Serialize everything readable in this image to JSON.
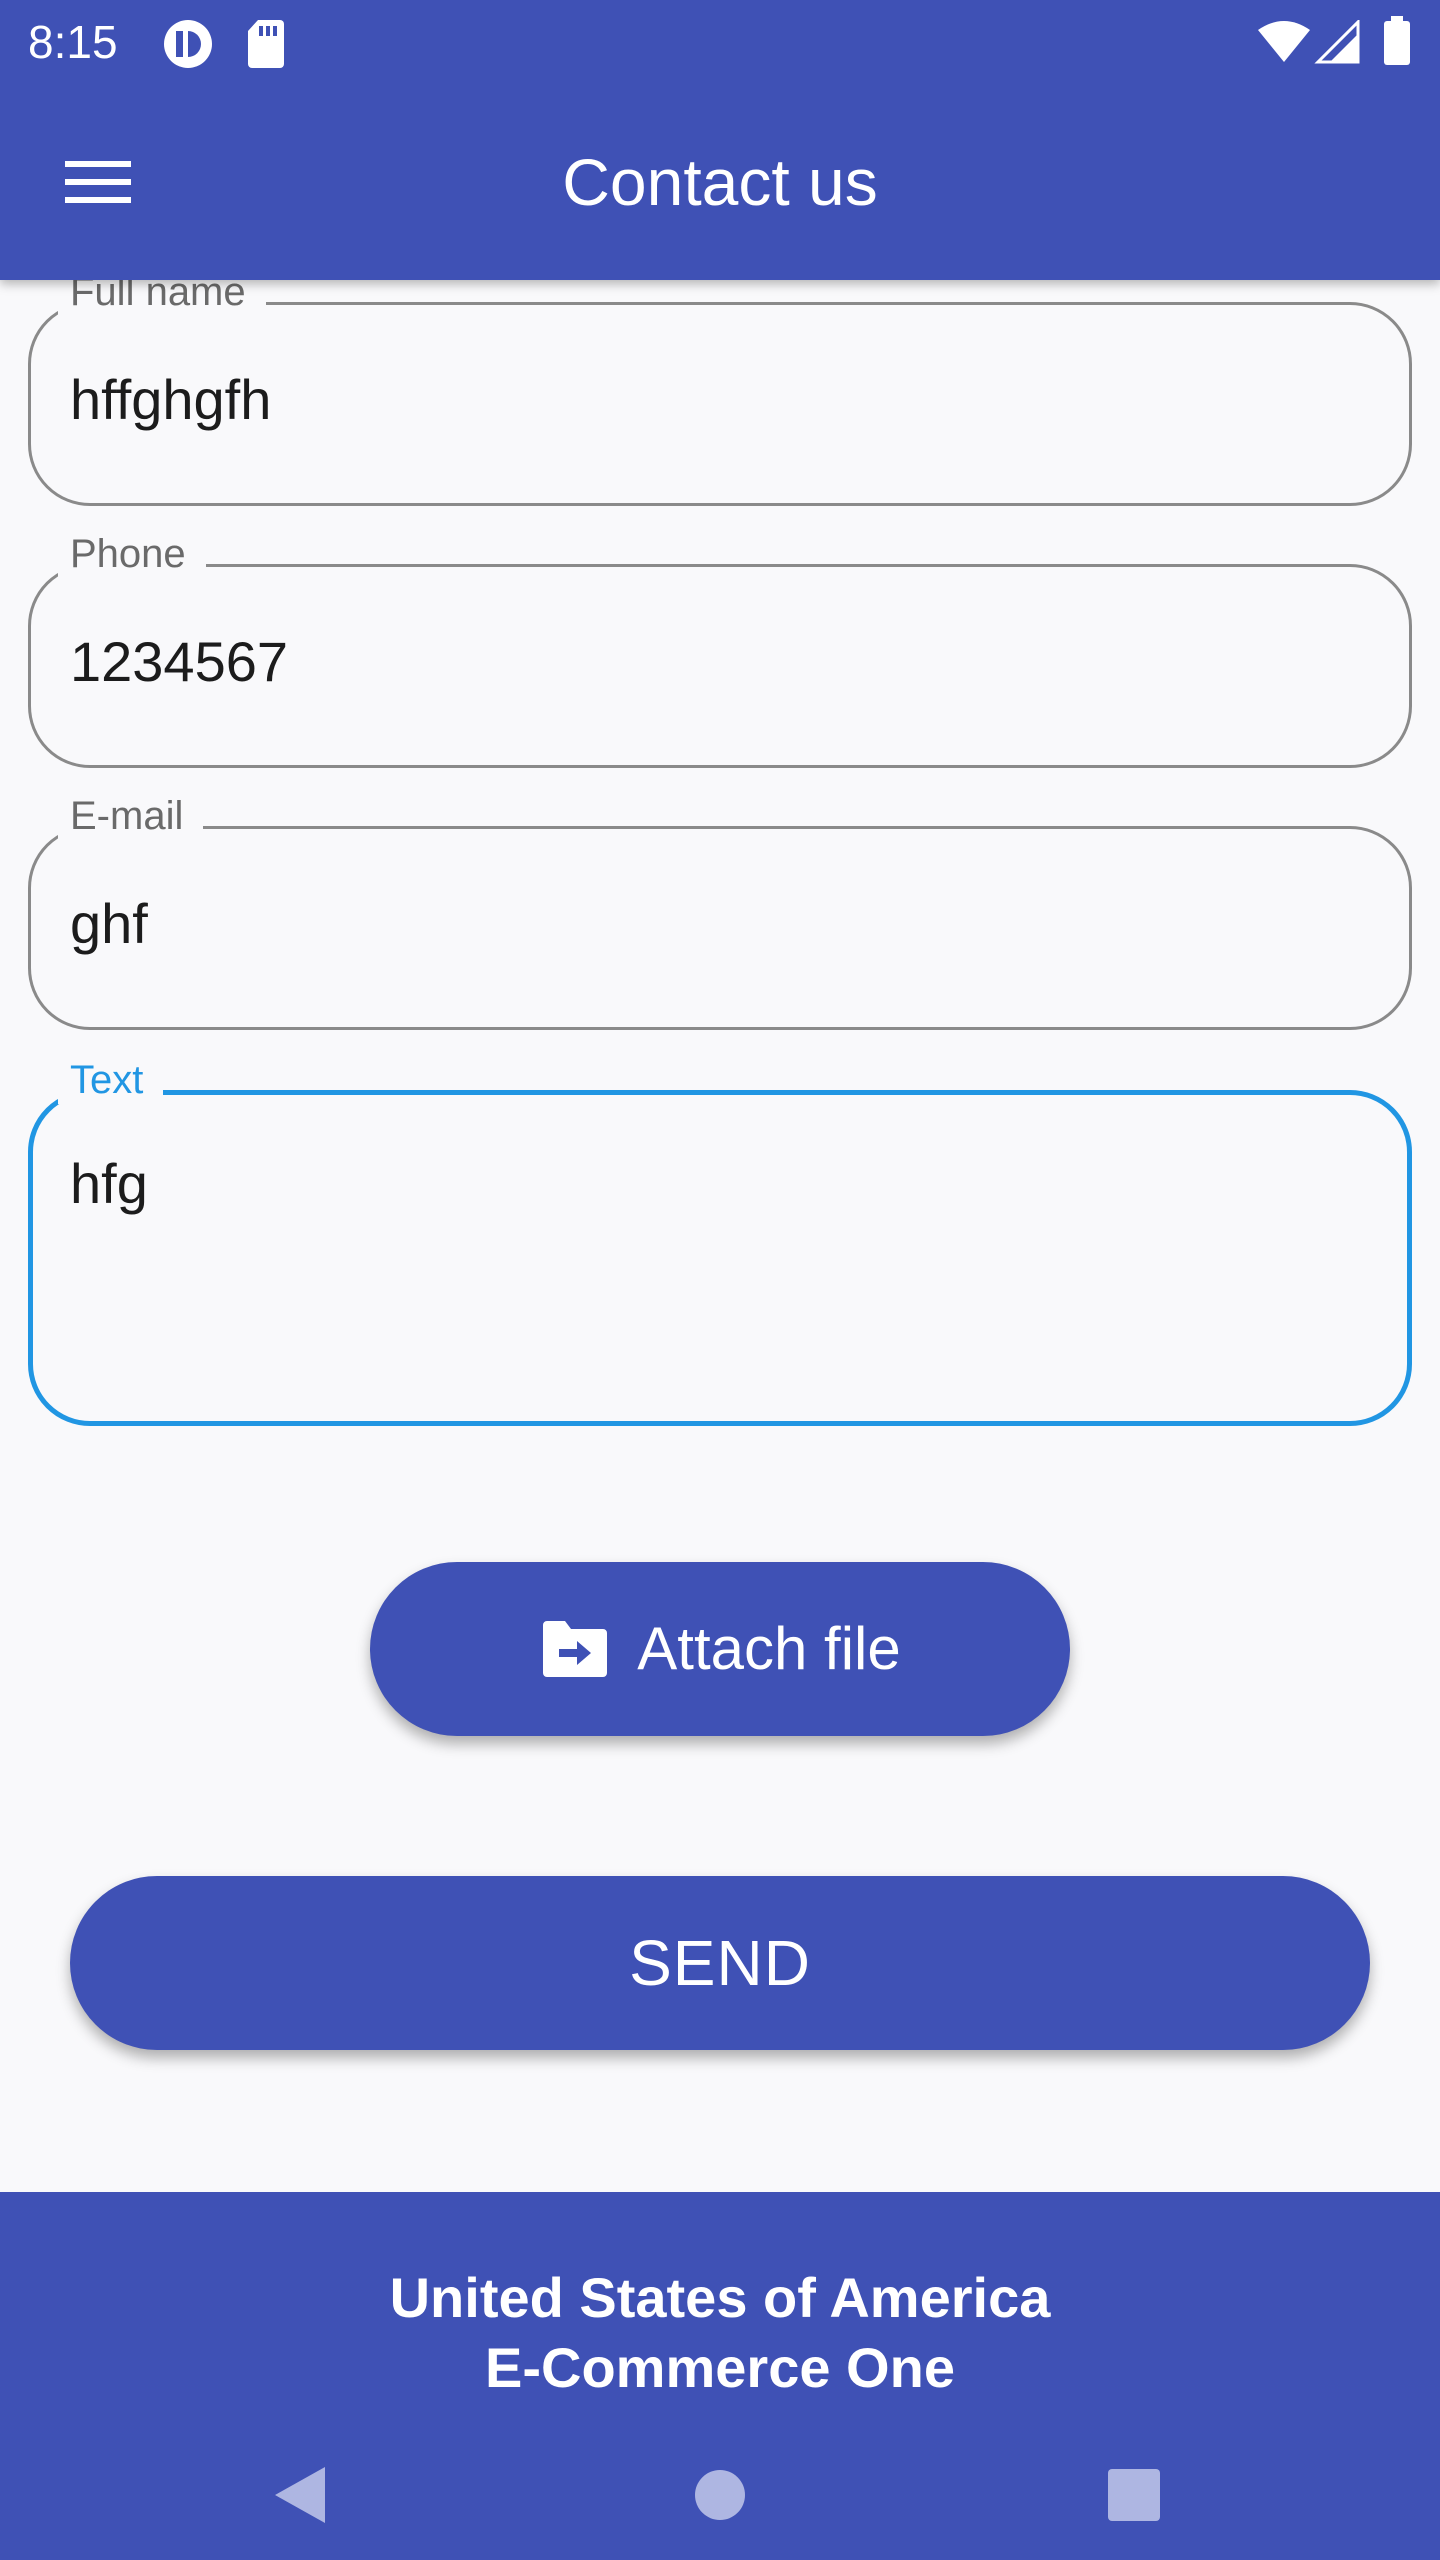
{
  "status_bar": {
    "time": "8:15",
    "icons": [
      "notification-app-icon",
      "sd-card-icon",
      "wifi-icon",
      "cell-signal-icon",
      "battery-icon"
    ]
  },
  "app_bar": {
    "title": "Contact us",
    "menu_icon": "hamburger-menu-icon",
    "color": "#3f51b5"
  },
  "form": {
    "full_name": {
      "label": "Full name",
      "value": "hffghgfh"
    },
    "phone": {
      "label": "Phone",
      "value": "1234567"
    },
    "email": {
      "label": "E-mail",
      "value": "ghf"
    },
    "text": {
      "label": "Text",
      "value": "hfg",
      "focused": true
    }
  },
  "buttons": {
    "attach_file": "Attach file",
    "attach_icon": "folder-move-icon",
    "send": "SEND"
  },
  "footer": {
    "line1": "United States of America",
    "line2": "E-Commerce One"
  },
  "nav_bar": {
    "back_icon": "back-triangle-icon",
    "home_icon": "home-circle-icon",
    "recents_icon": "recents-square-icon"
  },
  "colors": {
    "primary": "#3f51b5",
    "focus": "#2196e3",
    "outline": "#8a8a8a",
    "background": "#f9f9fb"
  }
}
